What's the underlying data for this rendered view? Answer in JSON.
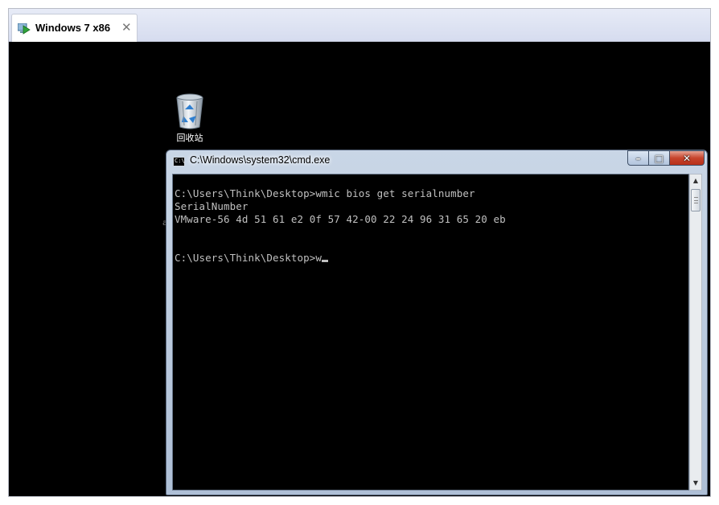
{
  "vmware": {
    "tab_title": "Windows 7 x86",
    "tab_close": "✕"
  },
  "desktop": {
    "recycle_bin_label": "回收站",
    "stray_text": "a"
  },
  "cmd": {
    "icon_text": "C:\\",
    "title": "C:\\Windows\\system32\\cmd.exe",
    "buttons": {
      "minimize": "–",
      "maximize": "□",
      "close": "✕"
    },
    "lines": [
      "C:\\Users\\Think\\Desktop>wmic bios get serialnumber",
      "SerialNumber",
      "VMware-56 4d 51 61 e2 0f 57 42-00 22 24 96 31 65 20 eb",
      "",
      "",
      "C:\\Users\\Think\\Desktop>w"
    ]
  },
  "scrollbar": {
    "up_arrow": "▲",
    "down_arrow": "▼"
  },
  "colors": {
    "console_text": "#c0c0c0",
    "console_bg": "#000000",
    "close_button": "#c7442c"
  }
}
